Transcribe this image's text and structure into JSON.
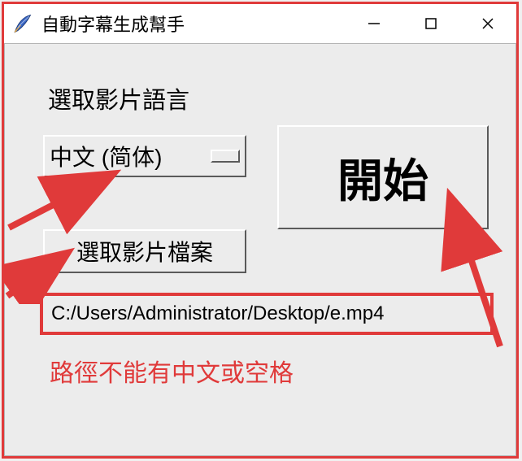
{
  "window": {
    "title": "自動字幕生成幫手"
  },
  "main": {
    "languageLabel": "選取影片語言",
    "languageSelected": "中文 (简体)",
    "startLabel": "開始",
    "selectFileLabel": "選取影片檔案",
    "filePath": "C:/Users/Administrator/Desktop/e.mp4",
    "pathNote": "路徑不能有中文或空格"
  },
  "annotations": {
    "arrowColor": "#e03a3a"
  }
}
